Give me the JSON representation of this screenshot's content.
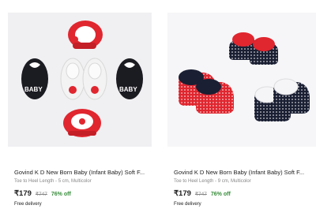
{
  "products": [
    {
      "title": "Govind K D New Born Baby (Infant Baby) Soft F...",
      "subtitle": "Toe to Heel Length - 5 cm, Multicolor",
      "price": "₹179",
      "mrp": "₹747",
      "discount": "76% off",
      "delivery": "Free delivery",
      "image_text": "BABY",
      "colors": {
        "red": "#e0262f",
        "black": "#1b1b22",
        "white": "#f3f3f3",
        "accent": "#388e3c"
      }
    },
    {
      "title": "Govind K D New Born Baby (Infant Baby) Soft F...",
      "subtitle": "Toe to Heel Length - 9 cm, Multicolor",
      "price": "₹179",
      "mrp": "₹747",
      "discount": "76% off",
      "delivery": "Free delivery",
      "colors": {
        "red": "#e0262f",
        "navy": "#1a1f33",
        "white": "#f5f5f7",
        "accent": "#388e3c"
      }
    }
  ]
}
